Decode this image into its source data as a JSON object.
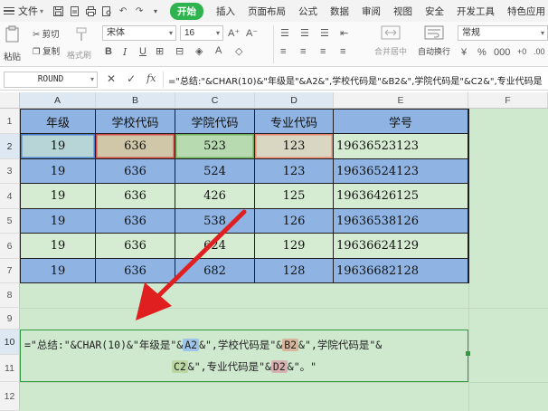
{
  "menubar": {
    "file_label": "文件",
    "tabs": [
      "开始",
      "插入",
      "页面布局",
      "公式",
      "数据",
      "审阅",
      "视图",
      "安全",
      "开发工具",
      "特色应用"
    ],
    "active_tab": "开始"
  },
  "ribbon": {
    "paste_label": "粘贴",
    "cut_label": "剪切",
    "copy_label": "复制",
    "format_painter_label": "格式刷",
    "font_name": "宋体",
    "font_size": "16",
    "merge_label": "合并居中",
    "wrap_label": "自动换行",
    "number_format": "常规"
  },
  "formula_bar": {
    "name_box": "ROUND",
    "cancel_icon": "✕",
    "confirm_icon": "✓",
    "fx_label": "fx",
    "formula": "=\"总结:\"&CHAR(10)&\"年级是\"&A2&\",学校代码是\"&B2&\",学院代码是\"&C2&\",专业代码是"
  },
  "columns": [
    "A",
    "B",
    "C",
    "D",
    "E",
    "F"
  ],
  "rows": [
    "1",
    "2",
    "3",
    "4",
    "5",
    "6",
    "7",
    "8",
    "9",
    "10",
    "11",
    "12"
  ],
  "table": {
    "headers": [
      "年级",
      "学校代码",
      "学院代码",
      "专业代码",
      "学号"
    ],
    "rows": [
      [
        "19",
        "636",
        "523",
        "123",
        "19636523123"
      ],
      [
        "19",
        "636",
        "524",
        "123",
        "19636524123"
      ],
      [
        "19",
        "636",
        "426",
        "125",
        "19636426125"
      ],
      [
        "19",
        "636",
        "538",
        "126",
        "19636538126"
      ],
      [
        "19",
        "636",
        "624",
        "129",
        "19636624129"
      ],
      [
        "19",
        "636",
        "682",
        "128",
        "19636682128"
      ]
    ]
  },
  "edit_cell": {
    "line1_p1": "=\"总结:\"&CHAR(10)&\"年级是\"&",
    "ref_a": "A2",
    "line1_p2": "&\",学校代码是\"&",
    "ref_b": "B2",
    "line1_p3": "&\",学院代码是\"&",
    "ref_c": "C2",
    "line2_p1": "&\",专业代码是\"&",
    "ref_d": "D2",
    "line2_p2": "&\"。\""
  },
  "colors": {
    "header_blue": "#8fb4e3",
    "row_green": "#d6ecd2",
    "active_tab": "#2eb34f",
    "arrow_red": "#e02020"
  }
}
